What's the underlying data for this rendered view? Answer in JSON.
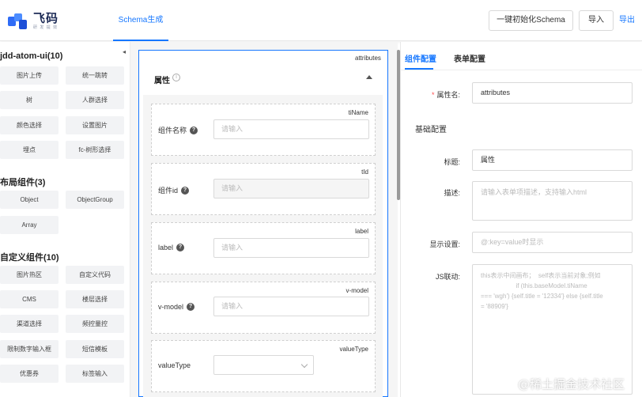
{
  "app": {
    "logo_title": "飞码",
    "logo_sub": "研 发 提 效",
    "nav_tab": "Schema生成",
    "btn_init": "一键初始化Schema",
    "btn_import": "导入",
    "link_export": "导出"
  },
  "sidebar": {
    "groups": [
      {
        "title": "jdd-atom-ui(10)",
        "items": [
          "图片上传",
          "统一跳转",
          "树",
          "人群选择",
          "颜色选择",
          "设置图片",
          "埋点",
          "fc-树形选择"
        ]
      },
      {
        "title": "布局组件(3)",
        "items": [
          "Object",
          "ObjectGroup",
          "Array"
        ]
      },
      {
        "title": "自定义组件(10)",
        "items": [
          "图片热区",
          "自定义代码",
          "CMS",
          "楼层选择",
          "渠道选择",
          "频控量控",
          "限制数字输入框",
          "短信模板",
          "优惠券",
          "标签输入"
        ]
      }
    ],
    "collapse_glyph": "◂"
  },
  "canvas": {
    "form_tag": "attributes",
    "section_title": "属性",
    "fields": [
      {
        "tag": "tiName",
        "label": "组件名称",
        "placeholder": "请输入",
        "type": "input"
      },
      {
        "tag": "tId",
        "label": "组件id",
        "placeholder": "请输入",
        "type": "input-disabled"
      },
      {
        "tag": "label",
        "label": "label",
        "placeholder": "请输入",
        "type": "input"
      },
      {
        "tag": "v-model",
        "label": "v-model",
        "placeholder": "请输入",
        "type": "input"
      },
      {
        "tag": "valueType",
        "label": "valueType",
        "placeholder": "",
        "type": "select"
      }
    ]
  },
  "props": {
    "tabs": [
      "组件配置",
      "表单配置"
    ],
    "name_label": "属性名:",
    "name_value": "attributes",
    "section": "基础配置",
    "title_label": "标题:",
    "title_value": "属性",
    "desc_label": "描述:",
    "desc_placeholder": "请输入表单项描述，支持输入html",
    "display_label": "显示设置:",
    "display_placeholder": "@:key=value时显示",
    "js_label": "JS联动:",
    "js_placeholder": "this表示中间画布；  self表示当前对象;例如\n                    if (this.baseModel.tiName\n=== 'wgh') {self.title = '12334'} else {self.title\n= '88909'}"
  },
  "watermark": "@稀土掘金技术社区",
  "colors": {
    "accent": "#1677ff",
    "required": "#ff4d4f"
  }
}
